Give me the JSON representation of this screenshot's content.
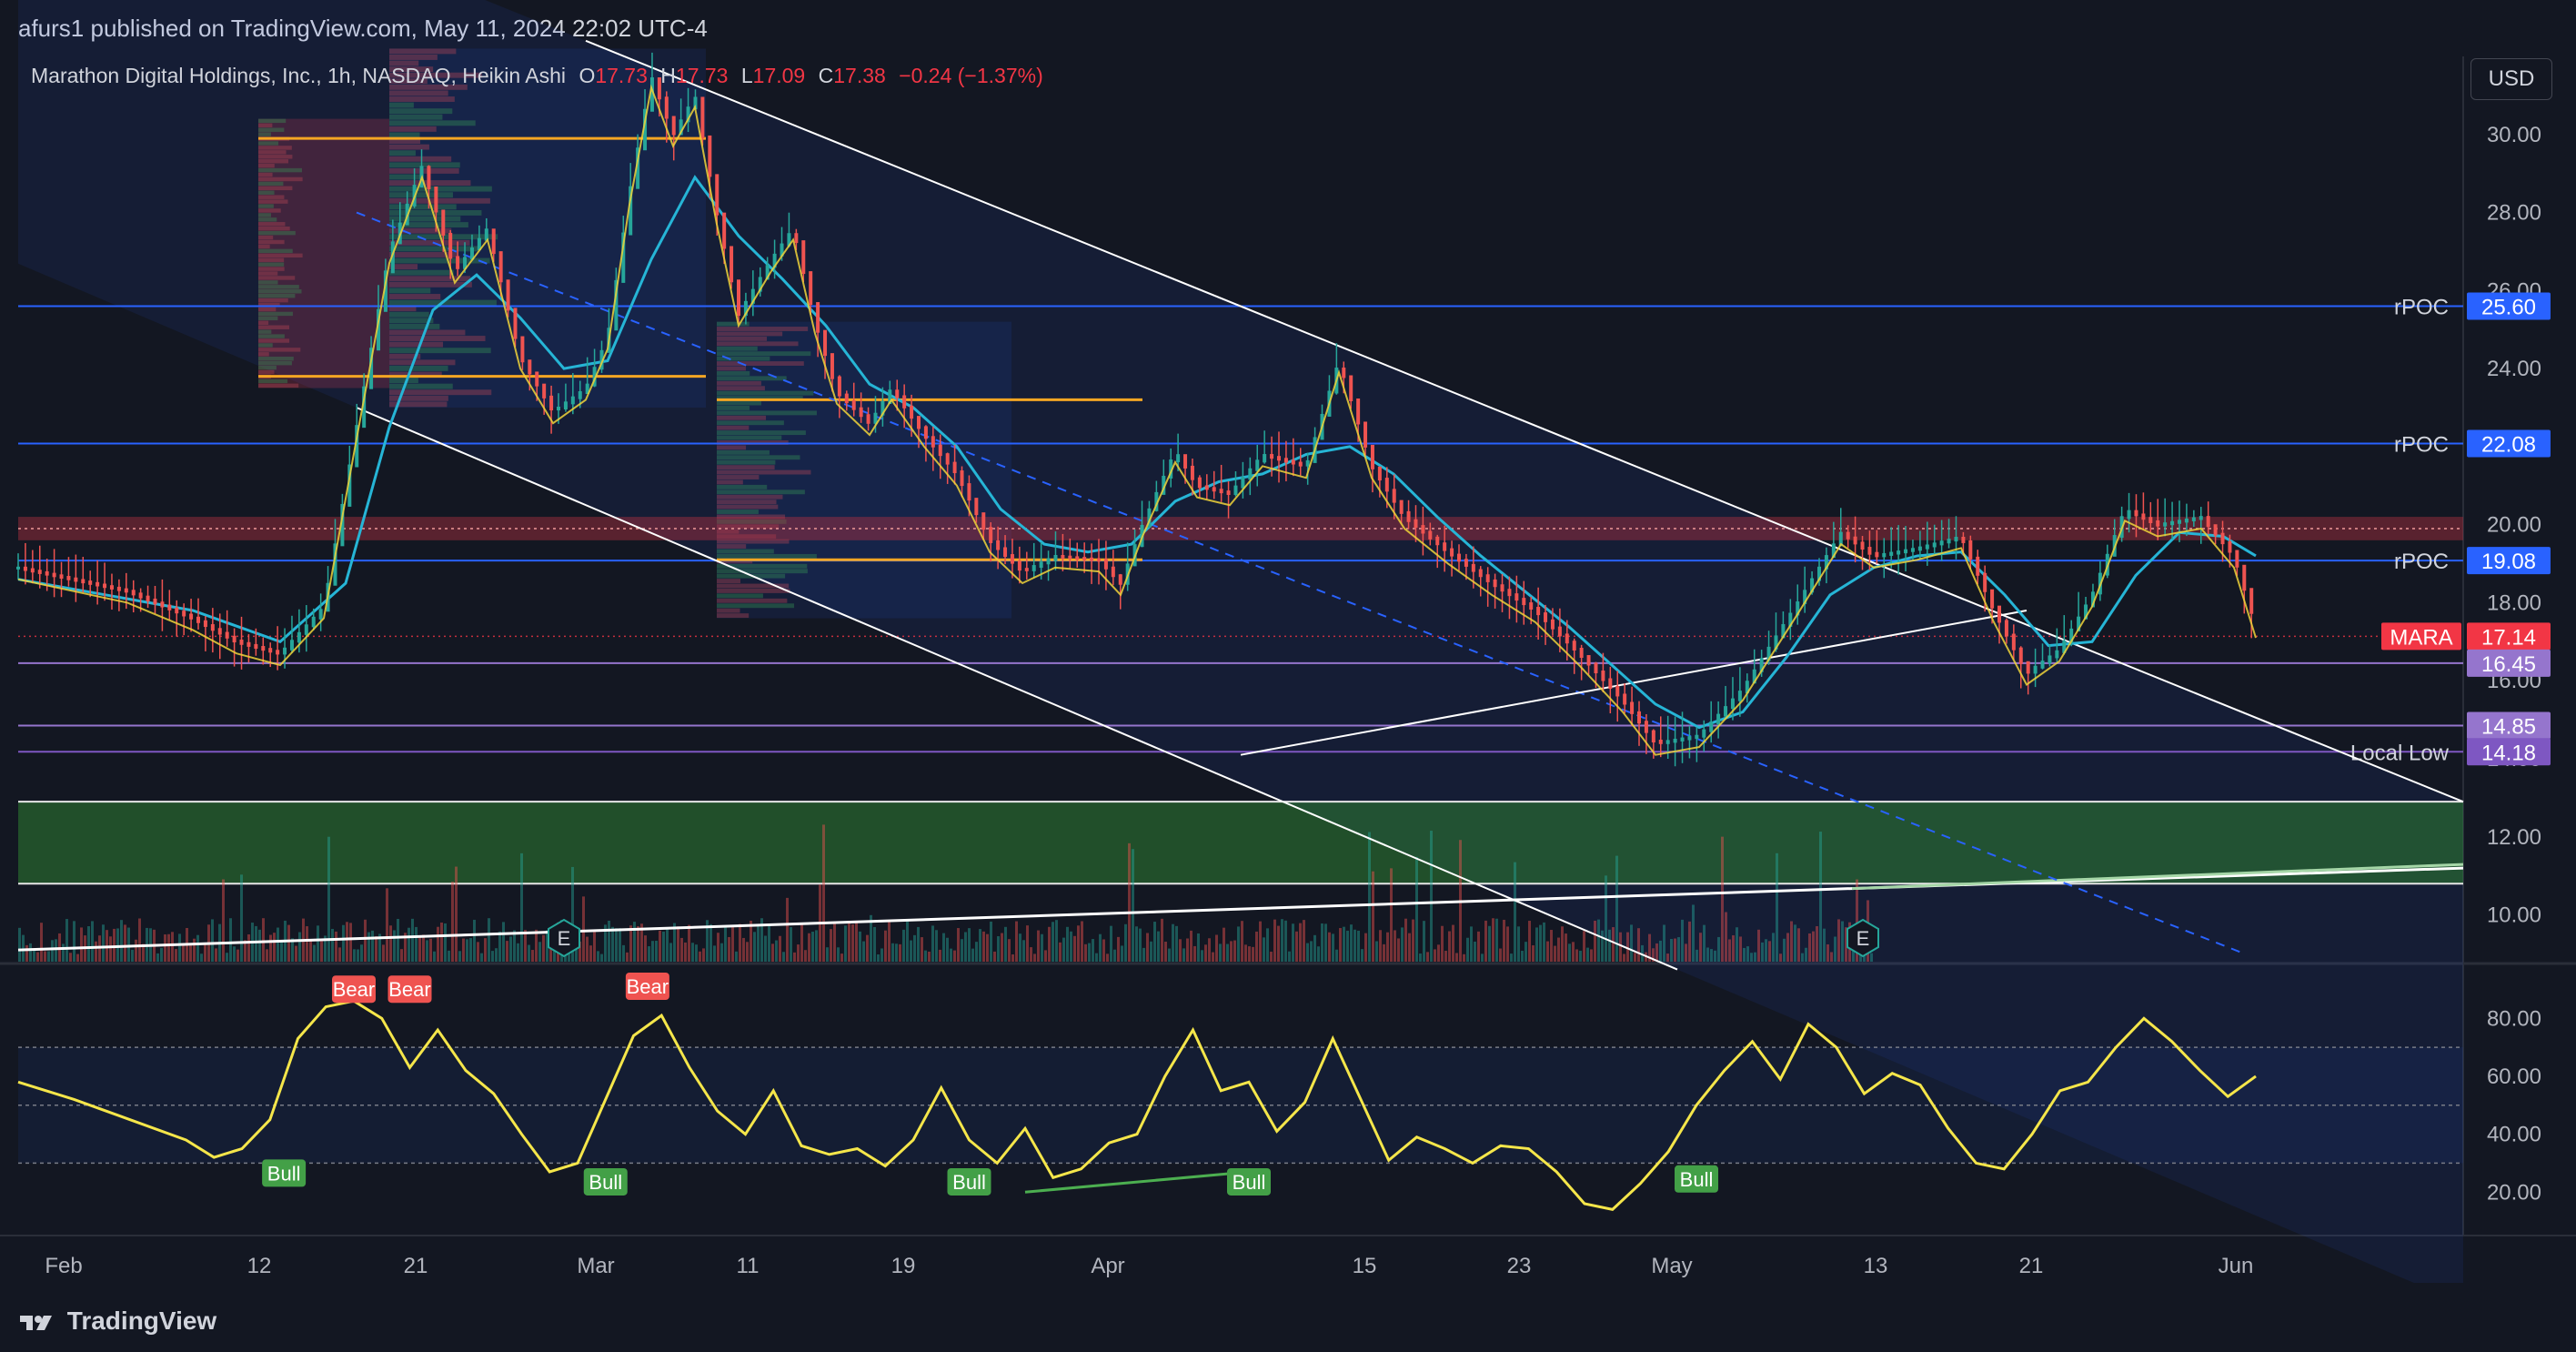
{
  "header": {
    "published": "afurs1 published on TradingView.com, May 11, 2024 22:02 UTC-4"
  },
  "legend": {
    "symbol": "Marathon Digital Holdings, Inc., 1h, NASDAQ, Heikin Ashi",
    "o_label": "O",
    "o_value": "17.73",
    "h_label": "H",
    "h_value": "17.73",
    "l_label": "L",
    "l_value": "17.09",
    "c_label": "C",
    "c_value": "17.38",
    "change": "−0.24 (−1.37%)"
  },
  "currency_button": "USD",
  "footer": {
    "brand": "TradingView"
  },
  "chart_data": [
    {
      "type": "line",
      "title": "Marathon Digital Holdings, Inc., 1h, NASDAQ, Heikin Ashi",
      "x_ticks": [
        "Feb",
        "12",
        "21",
        "Mar",
        "11",
        "19",
        "Apr",
        "15",
        "23",
        "May",
        "13",
        "21",
        "Jun"
      ],
      "y_ticks": [
        10,
        12,
        14,
        16,
        18,
        20,
        22,
        24,
        26,
        28,
        30
      ],
      "y_tick_labels": [
        "10.00",
        "12.00",
        "14.00",
        "16.00",
        "18.00",
        "20.00",
        "22.00",
        "24.00",
        "26.00",
        "28.00",
        "30.00"
      ],
      "ylim": [
        8.8,
        32
      ],
      "price_path": [
        [
          0,
          18.9
        ],
        [
          5,
          18.3
        ],
        [
          8,
          17.6
        ],
        [
          10,
          17.0
        ],
        [
          12,
          16.7
        ],
        [
          14,
          17.9
        ],
        [
          15.5,
          22.5
        ],
        [
          17,
          27.0
        ],
        [
          18.5,
          29.2
        ],
        [
          20,
          26.5
        ],
        [
          21.5,
          27.6
        ],
        [
          23,
          24.3
        ],
        [
          24.5,
          22.9
        ],
        [
          26,
          23.5
        ],
        [
          27,
          24.8
        ],
        [
          28,
          28.5
        ],
        [
          29,
          31.5
        ],
        [
          30,
          30.0
        ],
        [
          31,
          31.0
        ],
        [
          32,
          28.0
        ],
        [
          33,
          25.4
        ],
        [
          34.5,
          26.8
        ],
        [
          35.5,
          27.6
        ],
        [
          36.5,
          25.2
        ],
        [
          37.5,
          23.4
        ],
        [
          39,
          22.6
        ],
        [
          40,
          23.5
        ],
        [
          41.5,
          22.3
        ],
        [
          43,
          21.3
        ],
        [
          44.5,
          19.6
        ],
        [
          46,
          18.8
        ],
        [
          47.5,
          19.2
        ],
        [
          49.5,
          19.1
        ],
        [
          50.5,
          18.5
        ],
        [
          51.5,
          20.0
        ],
        [
          53,
          21.9
        ],
        [
          54,
          21.0
        ],
        [
          55.5,
          20.8
        ],
        [
          57,
          21.8
        ],
        [
          59,
          21.5
        ],
        [
          60.5,
          24.2
        ],
        [
          62,
          21.5
        ],
        [
          63.5,
          20.2
        ],
        [
          65.5,
          19.3
        ],
        [
          67.5,
          18.5
        ],
        [
          69.5,
          17.8
        ],
        [
          71.5,
          16.7
        ],
        [
          73.5,
          15.5
        ],
        [
          75,
          14.4
        ],
        [
          77,
          14.6
        ],
        [
          79,
          15.8
        ],
        [
          81.5,
          18.0
        ],
        [
          83.5,
          19.8
        ],
        [
          85,
          19.2
        ],
        [
          87,
          19.4
        ],
        [
          89,
          19.7
        ],
        [
          90.5,
          17.8
        ],
        [
          92,
          16.2
        ],
        [
          93.5,
          16.8
        ],
        [
          95,
          18.2
        ],
        [
          96.5,
          20.4
        ],
        [
          98,
          20.0
        ],
        [
          100,
          20.2
        ],
        [
          101.5,
          19.2
        ],
        [
          102.5,
          17.4
        ]
      ],
      "ema_path": [
        [
          0,
          18.6
        ],
        [
          8,
          17.8
        ],
        [
          12,
          17.0
        ],
        [
          15,
          18.5
        ],
        [
          17,
          22.5
        ],
        [
          19,
          25.5
        ],
        [
          21,
          26.4
        ],
        [
          23,
          25.3
        ],
        [
          25,
          24.0
        ],
        [
          27,
          24.2
        ],
        [
          29,
          26.8
        ],
        [
          31,
          28.9
        ],
        [
          33,
          27.4
        ],
        [
          35,
          26.3
        ],
        [
          37,
          25.1
        ],
        [
          39,
          23.6
        ],
        [
          41,
          23.0
        ],
        [
          43,
          22.0
        ],
        [
          45,
          20.4
        ],
        [
          47,
          19.5
        ],
        [
          49,
          19.3
        ],
        [
          51,
          19.5
        ],
        [
          53,
          20.6
        ],
        [
          55,
          21.1
        ],
        [
          57,
          21.3
        ],
        [
          59,
          21.8
        ],
        [
          61,
          22.0
        ],
        [
          63,
          21.3
        ],
        [
          65,
          20.2
        ],
        [
          67,
          19.2
        ],
        [
          69,
          18.3
        ],
        [
          71,
          17.4
        ],
        [
          73,
          16.4
        ],
        [
          75,
          15.4
        ],
        [
          77,
          14.8
        ],
        [
          79,
          15.2
        ],
        [
          81,
          16.6
        ],
        [
          83,
          18.2
        ],
        [
          85,
          18.9
        ],
        [
          87,
          19.2
        ],
        [
          89,
          19.3
        ],
        [
          91,
          18.2
        ],
        [
          93,
          16.9
        ],
        [
          95,
          17.0
        ],
        [
          97,
          18.7
        ],
        [
          99,
          19.8
        ],
        [
          101,
          19.7
        ],
        [
          102.5,
          19.2
        ]
      ],
      "channel_upper": [
        [
          26,
          32.4
        ],
        [
          112,
          12.9
        ]
      ],
      "channel_lower": [
        [
          15.5,
          23.0
        ],
        [
          76,
          8.6
        ]
      ],
      "channel_mid": [
        [
          15.5,
          28.0
        ],
        [
          102,
          9.0
        ]
      ],
      "wedge_lower": [
        [
          56,
          14.1
        ],
        [
          92,
          17.8
        ]
      ],
      "long_trendline": [
        [
          0,
          9.1
        ],
        [
          112,
          11.2
        ]
      ],
      "overlay_boxes": [
        {
          "x": [
            11,
            17
          ],
          "y": [
            23.5,
            30.4
          ],
          "color": "#e0405a"
        },
        {
          "x": [
            17,
            31.5
          ],
          "y": [
            23.0,
            32.2
          ],
          "color": "#2962ff"
        },
        {
          "x": [
            32,
            45.5
          ],
          "y": [
            17.6,
            25.2
          ],
          "color": "#2962ff"
        }
      ],
      "volume_profile_poc": [
        {
          "x": [
            11,
            31.5
          ],
          "y": 29.9
        },
        {
          "x": [
            11,
            31.5
          ],
          "y": 23.8
        },
        {
          "x": [
            32,
            51.5
          ],
          "y": 23.2
        },
        {
          "x": [
            32,
            51.5
          ],
          "y": 19.1
        }
      ],
      "levels": [
        {
          "name": "rPOC",
          "value": 25.6,
          "color": "#2962ff"
        },
        {
          "name": "rPOC",
          "value": 22.08,
          "color": "#2962ff"
        },
        {
          "name": "rPOC",
          "value": 19.08,
          "color": "#2962ff"
        },
        {
          "name": "MARA",
          "value": 17.14,
          "color": "#f23645"
        },
        {
          "name": "",
          "value": 16.45,
          "color": "#9575cd"
        },
        {
          "name": "",
          "value": 14.85,
          "color": "#9575cd"
        },
        {
          "name": "Local Low",
          "value": 14.18,
          "color": "#7e57c2"
        }
      ],
      "level_labels": [
        "25.60",
        "22.08",
        "19.08",
        "17.14",
        "16.45",
        "14.85",
        "14.18"
      ],
      "resistance_zone": [
        19.6,
        20.2
      ],
      "demand_zone": [
        10.8,
        12.9
      ],
      "earnings_markers": [
        25,
        84.5
      ],
      "earnings_label": "E"
    },
    {
      "type": "line",
      "title": "",
      "y_ticks": [
        20,
        40,
        60,
        80
      ],
      "y_tick_labels": [
        "20.00",
        "40.00",
        "60.00",
        "80.00"
      ],
      "ylim": [
        5,
        98
      ],
      "band": [
        30,
        70
      ],
      "midline": 50,
      "path": [
        [
          0,
          58
        ],
        [
          2,
          52
        ],
        [
          4,
          45
        ],
        [
          6,
          38
        ],
        [
          7,
          32
        ],
        [
          8,
          35
        ],
        [
          9,
          45
        ],
        [
          10,
          73
        ],
        [
          11,
          84
        ],
        [
          12,
          86
        ],
        [
          13,
          80
        ],
        [
          14,
          63
        ],
        [
          15,
          76
        ],
        [
          16,
          62
        ],
        [
          17,
          54
        ],
        [
          18,
          40
        ],
        [
          19,
          27
        ],
        [
          20,
          30
        ],
        [
          21,
          52
        ],
        [
          22,
          74
        ],
        [
          23,
          81
        ],
        [
          24,
          63
        ],
        [
          25,
          48
        ],
        [
          26,
          40
        ],
        [
          27,
          55
        ],
        [
          28,
          36
        ],
        [
          29,
          33
        ],
        [
          30,
          35
        ],
        [
          31,
          29
        ],
        [
          32,
          38
        ],
        [
          33,
          56
        ],
        [
          34,
          38
        ],
        [
          35,
          30
        ],
        [
          36,
          42
        ],
        [
          37,
          25
        ],
        [
          38,
          28
        ],
        [
          39,
          37
        ],
        [
          40,
          40
        ],
        [
          41,
          60
        ],
        [
          42,
          76
        ],
        [
          43,
          55
        ],
        [
          44,
          58
        ],
        [
          45,
          41
        ],
        [
          46,
          51
        ],
        [
          47,
          73
        ],
        [
          48,
          52
        ],
        [
          49,
          31
        ],
        [
          50,
          39
        ],
        [
          51,
          35
        ],
        [
          52,
          30
        ],
        [
          53,
          36
        ],
        [
          54,
          35
        ],
        [
          55,
          27
        ],
        [
          56,
          16
        ],
        [
          57,
          14
        ],
        [
          58,
          23
        ],
        [
          59,
          34
        ],
        [
          60,
          50
        ],
        [
          61,
          62
        ],
        [
          62,
          72
        ],
        [
          63,
          59
        ],
        [
          64,
          78
        ],
        [
          65,
          70
        ],
        [
          66,
          54
        ],
        [
          67,
          61
        ],
        [
          68,
          57
        ],
        [
          69,
          42
        ],
        [
          70,
          30
        ],
        [
          71,
          28
        ],
        [
          72,
          40
        ],
        [
          73,
          55
        ],
        [
          74,
          58
        ],
        [
          75,
          70
        ],
        [
          76,
          80
        ],
        [
          77,
          72
        ],
        [
          78,
          62
        ],
        [
          79,
          53
        ],
        [
          80,
          60
        ]
      ],
      "bull_label": "Bull",
      "bear_label": "Bear",
      "signals": [
        {
          "kind": "Bull",
          "x": 9.5,
          "y": 30
        },
        {
          "kind": "Bull",
          "x": 21,
          "y": 27
        },
        {
          "kind": "Bull",
          "x": 34,
          "y": 27
        },
        {
          "kind": "Bull",
          "x": 44,
          "y": 27
        },
        {
          "kind": "Bull",
          "x": 60,
          "y": 28
        },
        {
          "kind": "Bear",
          "x": 12,
          "y": 86
        },
        {
          "kind": "Bear",
          "x": 14,
          "y": 86
        },
        {
          "kind": "Bear",
          "x": 22.5,
          "y": 87
        }
      ]
    }
  ]
}
